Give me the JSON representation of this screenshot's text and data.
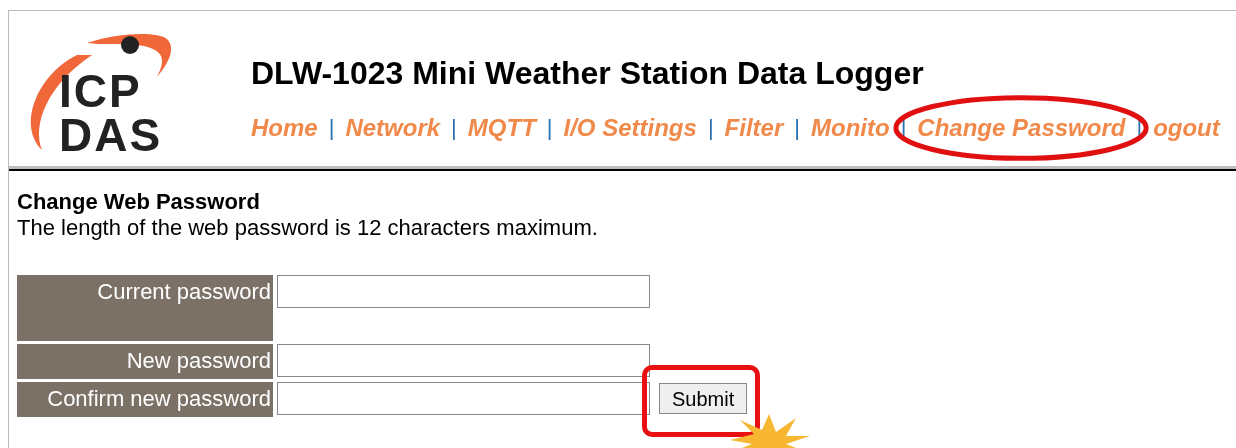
{
  "header": {
    "logo": [
      "ICP",
      "DAS"
    ],
    "title": "DLW-1023 Mini Weather Station Data Logger",
    "nav": [
      {
        "label": "Home",
        "circled": false
      },
      {
        "label": "Network",
        "circled": false
      },
      {
        "label": "MQTT",
        "circled": false
      },
      {
        "label": "I/O Settings",
        "circled": false
      },
      {
        "label": "Filter",
        "circled": false
      },
      {
        "label": "Monito",
        "circled": false
      },
      {
        "label": "Change Password",
        "circled": true
      },
      {
        "label": "ogout",
        "circled": false
      }
    ],
    "separator": "|"
  },
  "section": {
    "title": "Change Web Password",
    "description": "The length of the web password is 12 characters maximum."
  },
  "form": {
    "rows": [
      {
        "label": "Current password",
        "tall": true
      },
      {
        "label": "New password",
        "tall": false
      },
      {
        "label": "Confirm new password",
        "tall": false
      }
    ],
    "submit": "Submit"
  }
}
